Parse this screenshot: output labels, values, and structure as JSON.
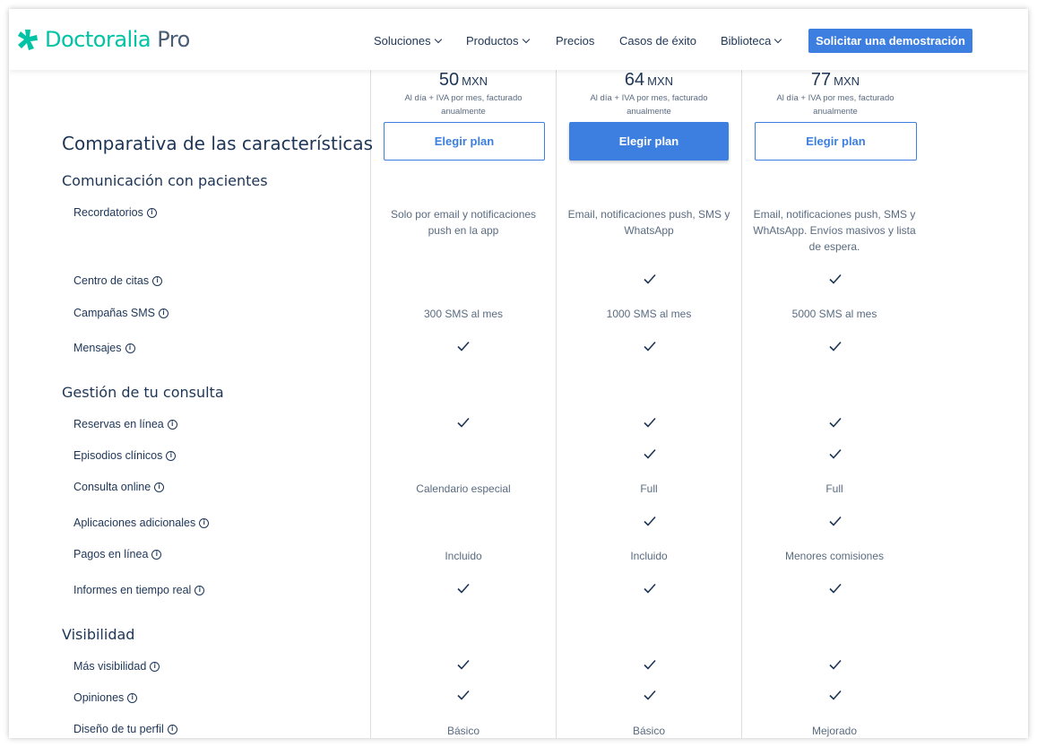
{
  "brand": {
    "name": "Doctoralia",
    "suffix": "Pro",
    "color": "#00c3a5"
  },
  "nav": {
    "items": [
      {
        "label": "Soluciones",
        "dropdown": true
      },
      {
        "label": "Productos",
        "dropdown": true
      },
      {
        "label": "Precios",
        "dropdown": false
      },
      {
        "label": "Casos de éxito",
        "dropdown": false
      },
      {
        "label": "Biblioteca",
        "dropdown": true
      }
    ],
    "cta_label": "Solicitar una demostración"
  },
  "accent_color": "#3c7fe0",
  "page_title": "Comparativa de las características",
  "plans": [
    {
      "price": "50",
      "currency": "MXN",
      "note": "Al día + IVA por mes, facturado anualmente",
      "button": "Elegir plan",
      "highlight": false
    },
    {
      "price": "64",
      "currency": "MXN",
      "note": "Al día + IVA por mes, facturado anualmente",
      "button": "Elegir plan",
      "highlight": true
    },
    {
      "price": "77",
      "currency": "MXN",
      "note": "Al día + IVA por mes, facturado anualmente",
      "button": "Elegir plan",
      "highlight": false
    }
  ],
  "sections": [
    {
      "title": "Comunicación con pacientes",
      "features": [
        {
          "name": "Recordatorios",
          "values": [
            "Solo por email y notificaciones push en la app",
            "Email, notificaciones push, SMS y WhatsApp",
            "Email, notificaciones push, SMS y WhAtsApp. Envíos masivos y lista de espera."
          ]
        },
        {
          "name": "Centro de citas",
          "values": [
            "",
            "check",
            "check"
          ]
        },
        {
          "name": "Campañas SMS",
          "values": [
            "300 SMS al mes",
            "1000 SMS al mes",
            "5000 SMS al mes"
          ]
        },
        {
          "name": "Mensajes",
          "values": [
            "check",
            "check",
            "check"
          ]
        }
      ]
    },
    {
      "title": "Gestión de tu consulta",
      "features": [
        {
          "name": "Reservas en línea",
          "values": [
            "check",
            "check",
            "check"
          ]
        },
        {
          "name": "Episodios clínicos",
          "values": [
            "",
            "check",
            "check"
          ]
        },
        {
          "name": "Consulta online",
          "values": [
            "Calendario especial",
            "Full",
            "Full"
          ]
        },
        {
          "name": "Aplicaciones adicionales",
          "values": [
            "",
            "check",
            "check"
          ]
        },
        {
          "name": "Pagos en línea",
          "values": [
            "Incluido",
            "Incluido",
            "Menores comisiones"
          ]
        },
        {
          "name": "Informes en tiempo real",
          "values": [
            "check",
            "check",
            "check"
          ]
        }
      ]
    },
    {
      "title": "Visibilidad",
      "features": [
        {
          "name": "Más visibilidad",
          "values": [
            "check",
            "check",
            "check"
          ]
        },
        {
          "name": "Opiniones",
          "values": [
            "check",
            "check",
            "check"
          ]
        },
        {
          "name": "Diseño de tu perfil",
          "values": [
            "Básico",
            "Básico",
            "Mejorado"
          ]
        }
      ]
    }
  ]
}
